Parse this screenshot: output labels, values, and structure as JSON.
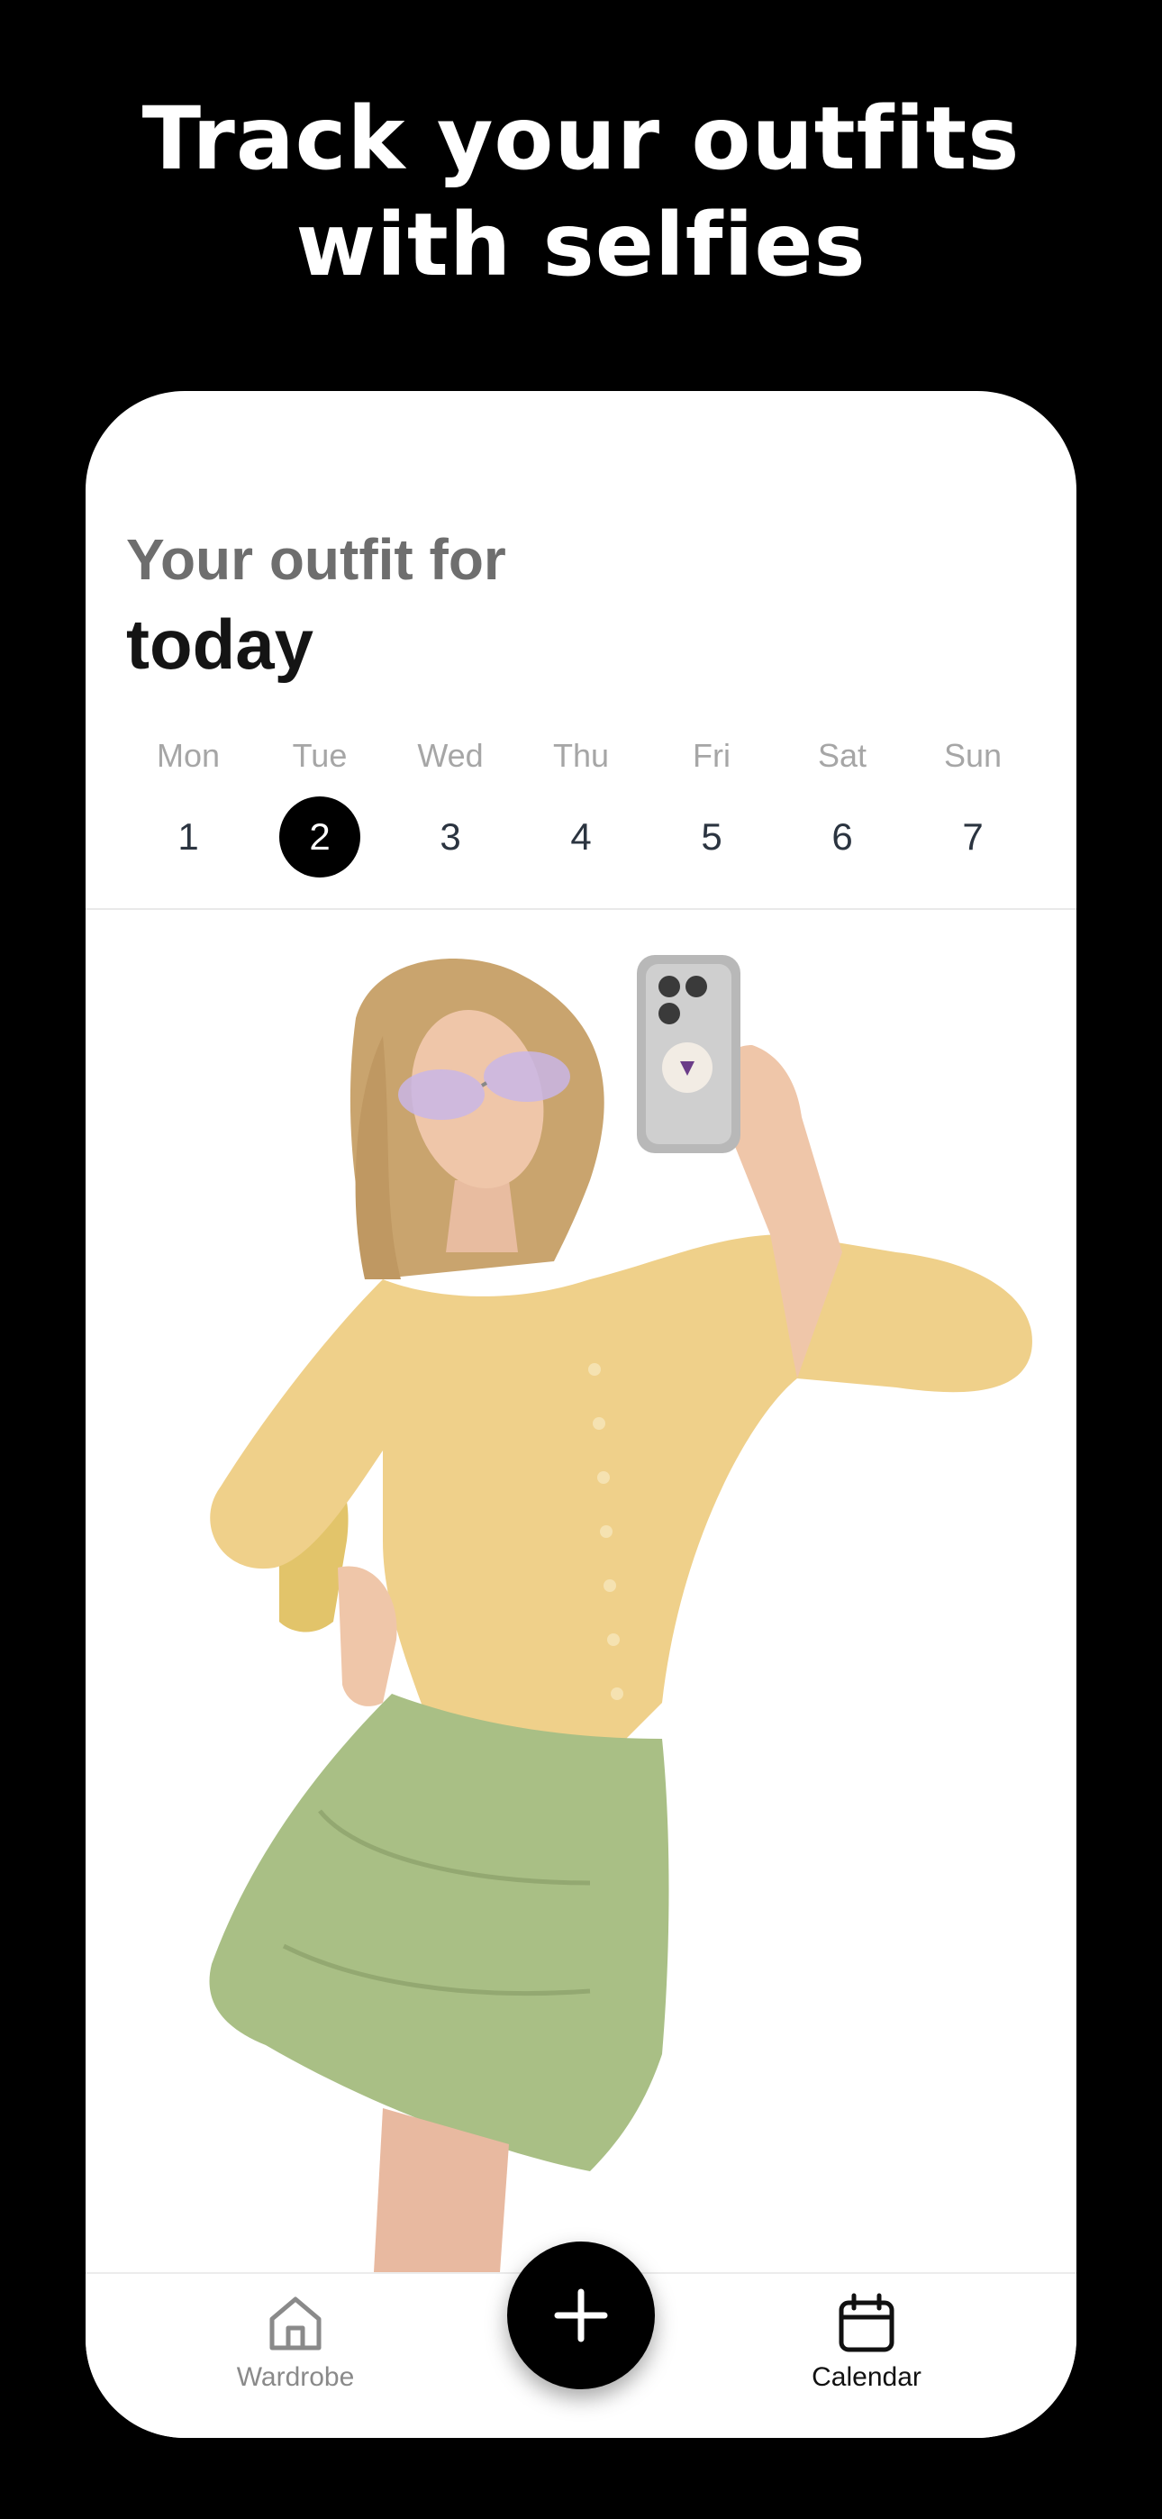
{
  "promo": {
    "headline_line1": "Track your outfits",
    "headline_line2": "with selfies"
  },
  "header": {
    "subtitle": "Your outfit for",
    "title": "today"
  },
  "week": {
    "days": [
      {
        "name": "Mon",
        "num": "1"
      },
      {
        "name": "Tue",
        "num": "2"
      },
      {
        "name": "Wed",
        "num": "3"
      },
      {
        "name": "Thu",
        "num": "4"
      },
      {
        "name": "Fri",
        "num": "5"
      },
      {
        "name": "Sat",
        "num": "6"
      },
      {
        "name": "Sun",
        "num": "7"
      }
    ],
    "selected": "2"
  },
  "outfit": {
    "image": "selfie-photo"
  },
  "nav": {
    "wardrobe_label": "Wardrobe",
    "wardrobe_icon": "home-icon",
    "add_icon": "plus-icon",
    "calendar_label": "Calendar",
    "calendar_icon": "calendar-icon"
  },
  "colors": {
    "background": "#000000",
    "card": "#ffffff",
    "accent": "#000000",
    "subtitle": "#6e6e6e",
    "day_name": "#a6a6a6",
    "top_yellow": "#efd08a",
    "skirt_green": "#a9bf85"
  }
}
